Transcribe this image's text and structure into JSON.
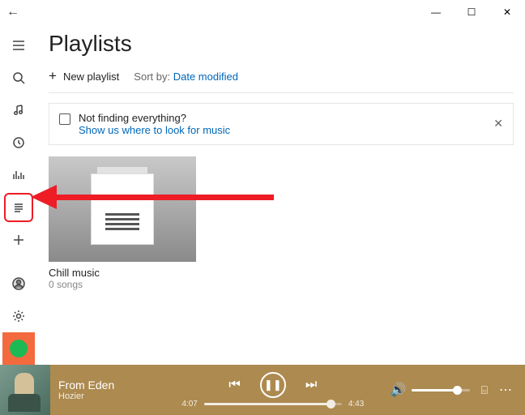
{
  "titlebar": {
    "min": "—",
    "max": "☐",
    "close": "✕",
    "back": "←"
  },
  "sidebar": {},
  "page": {
    "title": "Playlists",
    "new_playlist": "New playlist",
    "sort_label": "Sort by:",
    "sort_value": "Date modified"
  },
  "notice": {
    "title": "Not finding everything?",
    "link": "Show us where to look for music",
    "close": "✕"
  },
  "playlists": [
    {
      "name": "Chill music",
      "count": "0 songs"
    }
  ],
  "player": {
    "song": "From Eden",
    "artist": "Hozier",
    "elapsed": "4:07",
    "duration": "4:43",
    "progress_pct": 92,
    "volume_pct": 78,
    "more": "⋯"
  }
}
